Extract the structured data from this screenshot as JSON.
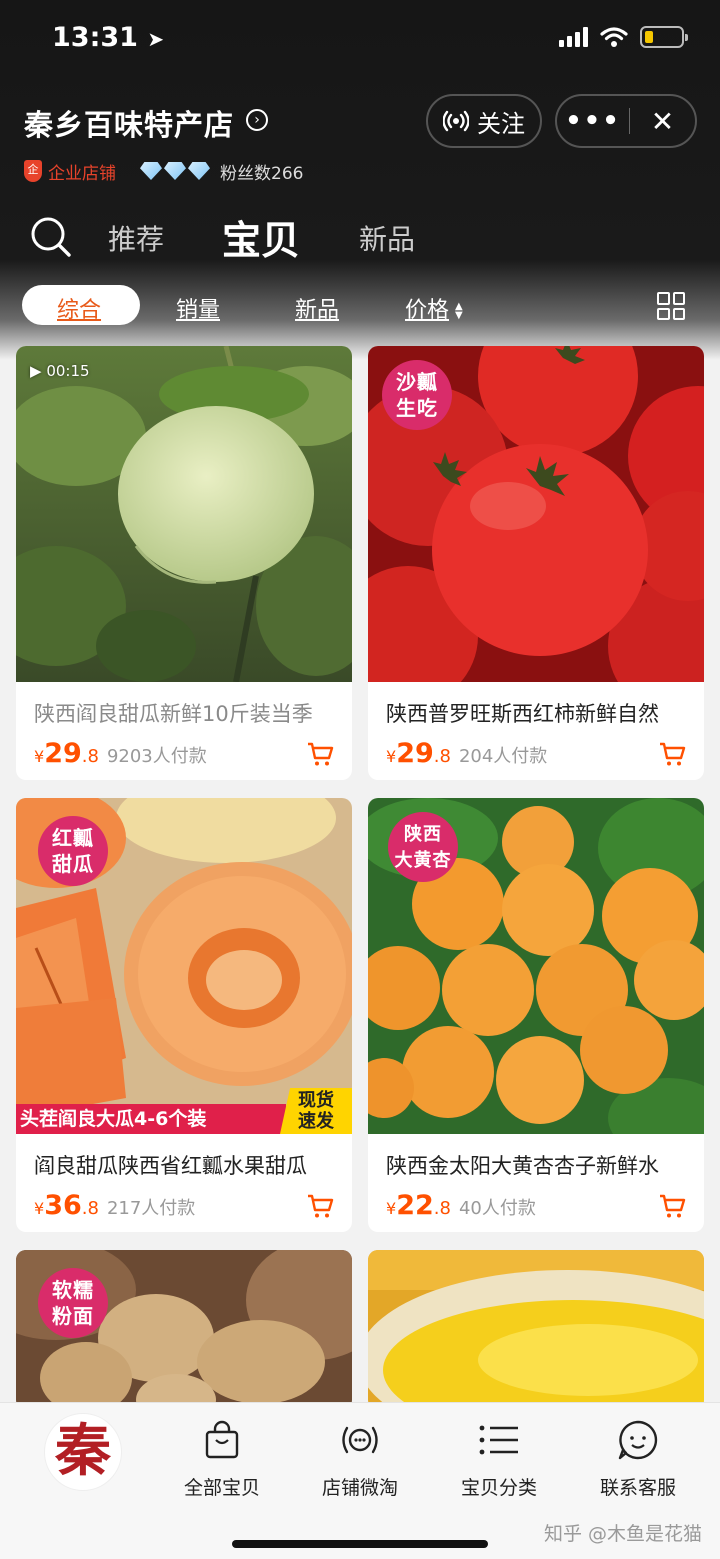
{
  "status_bar": {
    "time": "13:31"
  },
  "store": {
    "name": "秦乡百味特产店",
    "follow_label": "关注",
    "more_label": "•••",
    "close_label": "✕",
    "enterprise_badge": "企业店铺",
    "fans_label": "粉丝数266",
    "diamond_count": 3
  },
  "tabs": {
    "recommend": "推荐",
    "products": "宝贝",
    "new": "新品"
  },
  "filters": {
    "overall": "综合",
    "sales": "销量",
    "new": "新品",
    "price": "价格"
  },
  "products": [
    {
      "title": "陕西阎良甜瓜新鲜10斤装当季",
      "price_symbol": "¥",
      "price_int": "29",
      "price_dec": ".8",
      "paid": "9203人付款",
      "video": "00:15"
    },
    {
      "title": "陕西普罗旺斯西红柿新鲜自然",
      "price_symbol": "¥",
      "price_int": "29",
      "price_dec": ".8",
      "paid": "204人付款",
      "tag": [
        "沙瓤",
        "生吃"
      ]
    },
    {
      "title": "阎良甜瓜陕西省红瓤水果甜瓜",
      "price_symbol": "¥",
      "price_int": "36",
      "price_dec": ".8",
      "paid": "217人付款",
      "tag": [
        "红瓤",
        "甜瓜"
      ],
      "promo": "头茬阎良大瓜4-6个装",
      "promo_right": [
        "现货",
        "速发"
      ]
    },
    {
      "title": "陕西金太阳大黄杏杏子新鲜水",
      "price_symbol": "¥",
      "price_int": "22",
      "price_dec": ".8",
      "paid": "40人付款",
      "tag": [
        "陕西",
        "大黄杏"
      ]
    },
    {
      "tag": [
        "软糯",
        "粉面"
      ]
    },
    {}
  ],
  "bottom_nav": {
    "logo": "秦",
    "items": [
      "全部宝贝",
      "店铺微淘",
      "宝贝分类",
      "联系客服"
    ]
  },
  "watermark": "知乎 @木鱼是花猫",
  "colors": {
    "accent": "#ff5000",
    "header_bg": "#1a1a1a",
    "tag_pink": "#d92c6a",
    "enterprise_red": "#e8432b"
  }
}
